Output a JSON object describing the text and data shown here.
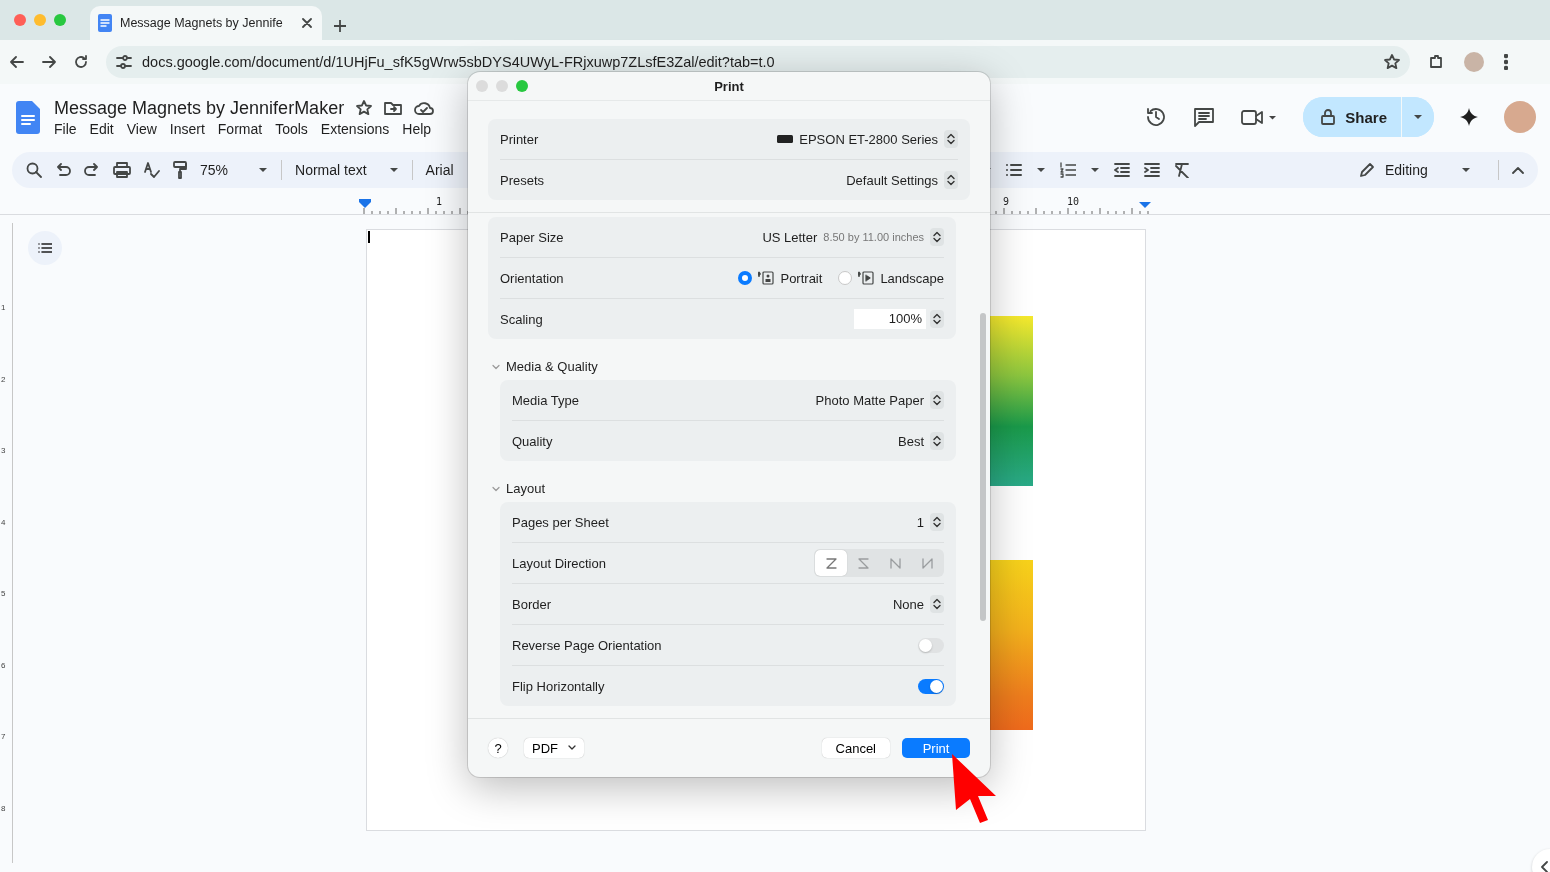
{
  "browser": {
    "tab_title": "Message Magnets by Jennife",
    "url": "docs.google.com/document/d/1UHjFu_sfK5gWrw5sbDYS4UWyL-FRjxuwp7ZLsfE3Zal/edit?tab=t.0"
  },
  "doc": {
    "title": "Message Magnets by JenniferMaker",
    "menu": [
      "File",
      "Edit",
      "View",
      "Insert",
      "Format",
      "Tools",
      "Extensions",
      "Help"
    ],
    "share": "Share",
    "zoom": "75%",
    "style": "Normal text",
    "font": "Arial",
    "mode": "Editing",
    "ruler_labels": [
      "1",
      "9",
      "10"
    ],
    "vertical_ruler_labels": [
      "1",
      "2",
      "3",
      "4",
      "5",
      "6",
      "7",
      "8"
    ]
  },
  "dialog": {
    "title": "Print",
    "top_rows": [
      {
        "kind": "device",
        "label": "Printer",
        "value": "EPSON ET-2800 Series"
      },
      {
        "kind": "select",
        "label": "Presets",
        "value": "Default Settings"
      }
    ],
    "rows": [
      {
        "kind": "select",
        "label": "Paper Size",
        "value": "US Letter",
        "detail": "8.50 by 11.00 inches"
      },
      {
        "kind": "radio",
        "label": "Orientation",
        "options": [
          {
            "label": "Portrait",
            "selected": true
          },
          {
            "label": "Landscape",
            "selected": false
          }
        ]
      },
      {
        "kind": "stepper",
        "label": "Scaling",
        "value": "100%"
      }
    ],
    "sections": [
      {
        "title": "Media & Quality",
        "expanded": true,
        "rows": [
          {
            "kind": "select",
            "label": "Media Type",
            "value": "Photo Matte Paper"
          },
          {
            "kind": "select",
            "label": "Quality",
            "value": "Best"
          }
        ]
      },
      {
        "title": "Layout",
        "expanded": true,
        "rows": [
          {
            "kind": "select",
            "label": "Pages per Sheet",
            "value": "1"
          },
          {
            "kind": "segmented",
            "label": "Layout Direction",
            "options": [
              {
                "selected": true
              },
              {
                "selected": false
              },
              {
                "selected": false
              },
              {
                "selected": false
              }
            ]
          },
          {
            "kind": "select",
            "label": "Border",
            "value": "None"
          },
          {
            "kind": "toggle",
            "label": "Reverse Page Orientation",
            "on": false
          },
          {
            "kind": "toggle",
            "label": "Flip Horizontally",
            "on": true
          }
        ]
      }
    ],
    "help": "?",
    "pdf": "PDF",
    "cancel": "Cancel",
    "print": "Print"
  }
}
